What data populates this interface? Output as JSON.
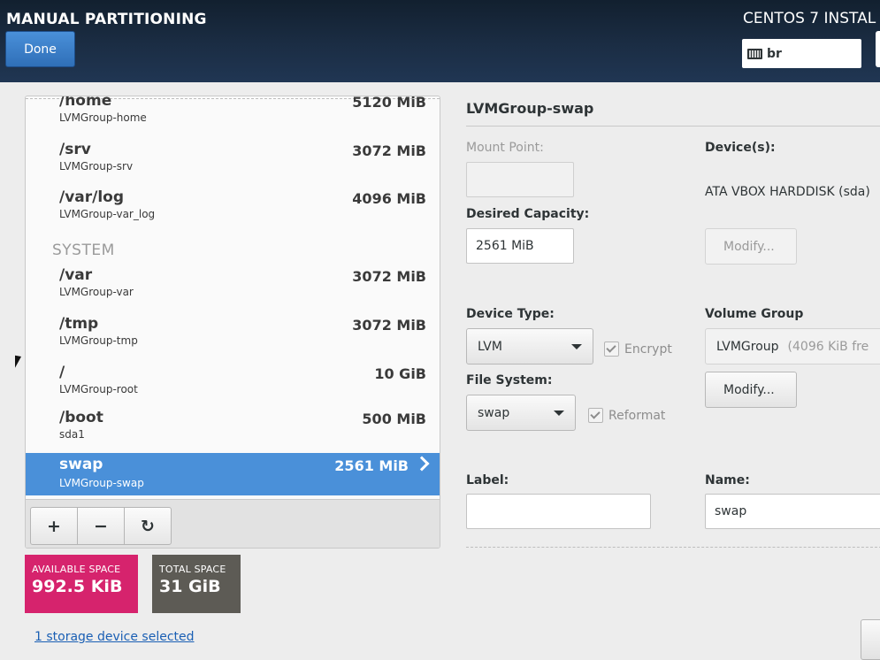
{
  "header": {
    "title": "MANUAL PARTITIONING",
    "product": "CENTOS 7 INSTAL",
    "done_label": "Done",
    "keyboard_layout": "br"
  },
  "partitions": {
    "rows": [
      {
        "mount": "/home",
        "device": "LVMGroup-home",
        "size": "5120 MiB"
      },
      {
        "mount": "/srv",
        "device": "LVMGroup-srv",
        "size": "3072 MiB"
      },
      {
        "mount": "/var/log",
        "device": "LVMGroup-var_log",
        "size": "4096 MiB"
      },
      {
        "mount": "/var",
        "device": "LVMGroup-var",
        "size": "3072 MiB"
      },
      {
        "mount": "/tmp",
        "device": "LVMGroup-tmp",
        "size": "3072 MiB"
      },
      {
        "mount": "/",
        "device": "LVMGroup-root",
        "size": "10 GiB"
      },
      {
        "mount": "/boot",
        "device": "sda1",
        "size": "500 MiB"
      },
      {
        "mount": "swap",
        "device": "LVMGroup-swap",
        "size": "2561 MiB"
      }
    ],
    "section_system": "SYSTEM",
    "tools": {
      "add": "+",
      "remove": "−",
      "refresh": "↻"
    }
  },
  "space": {
    "available_label": "AVAILABLE SPACE",
    "available_value": "992.5 KiB",
    "total_label": "TOTAL SPACE",
    "total_value": "31 GiB"
  },
  "storage_link": "1 storage device selected",
  "details": {
    "title": "LVMGroup-swap",
    "mount_point_label": "Mount Point:",
    "mount_point_value": "",
    "desired_capacity_label": "Desired Capacity:",
    "desired_capacity_value": "2561 MiB",
    "devices_label": "Device(s):",
    "devices_value": "ATA VBOX HARDDISK (sda)",
    "modify_label": "Modify...",
    "device_type_label": "Device Type:",
    "device_type_value": "LVM",
    "encrypt_label": "Encrypt",
    "file_system_label": "File System:",
    "file_system_value": "swap",
    "reformat_label": "Reformat",
    "volume_group_label": "Volume Group",
    "volume_group_value": "LVMGroup",
    "volume_group_free": "(4096 KiB fre",
    "vg_modify_label": "Modify...",
    "label_label": "Label:",
    "label_value": "",
    "name_label": "Name:",
    "name_value": "swap"
  },
  "colors": {
    "header_bg": "#1b2d44",
    "accent": "#4a90d9",
    "available": "#d6236d",
    "total": "#5d5b55"
  }
}
